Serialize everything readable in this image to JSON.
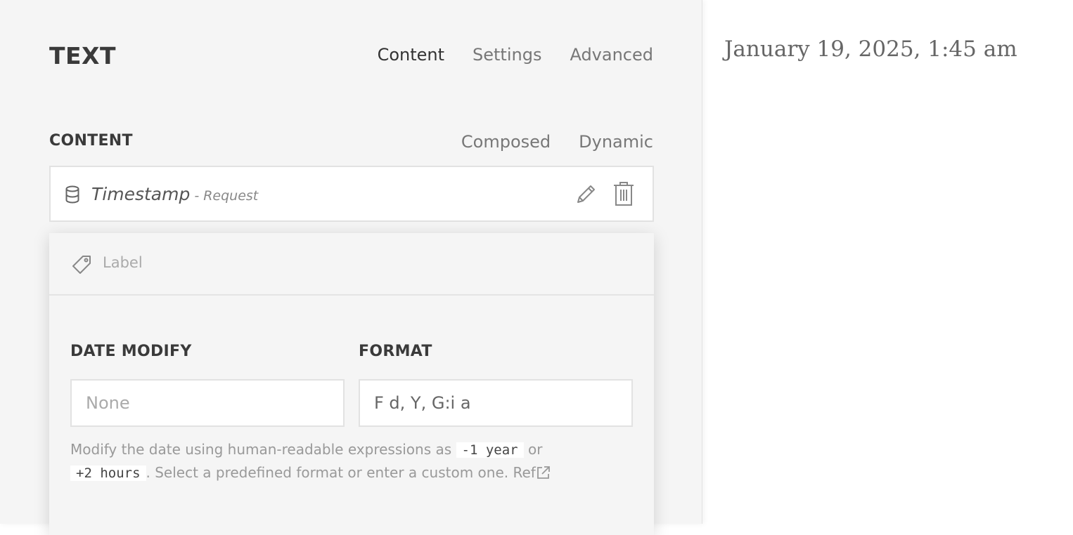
{
  "header": {
    "title": "TEXT",
    "tabs": [
      {
        "label": "Content",
        "active": true
      },
      {
        "label": "Settings",
        "active": false
      },
      {
        "label": "Advanced",
        "active": false
      }
    ]
  },
  "content_section": {
    "title": "CONTENT",
    "modes": [
      "Composed",
      "Dynamic"
    ]
  },
  "dynamic_field": {
    "icon": "database-icon",
    "name": "Timestamp",
    "source": "- Request"
  },
  "popup": {
    "label_placeholder": "Label",
    "date_modify": {
      "label": "DATE MODIFY",
      "value": "",
      "placeholder": "None"
    },
    "format": {
      "label": "FORMAT",
      "value": "F d, Y, G:i a"
    },
    "help": {
      "part1": "Modify the date using human-readable expressions as ",
      "code1": "-1 year",
      "part2": " or ",
      "code2": "+2 hours",
      "part3": ". Select a predefined format or enter a custom one. ",
      "ref": "Ref"
    }
  },
  "preview": {
    "text": "January 19, 2025, 1:45 am"
  },
  "colors": {
    "panel_bg": "#f5f5f5",
    "text_dark": "#3a3a3a",
    "text_muted": "#999999"
  }
}
